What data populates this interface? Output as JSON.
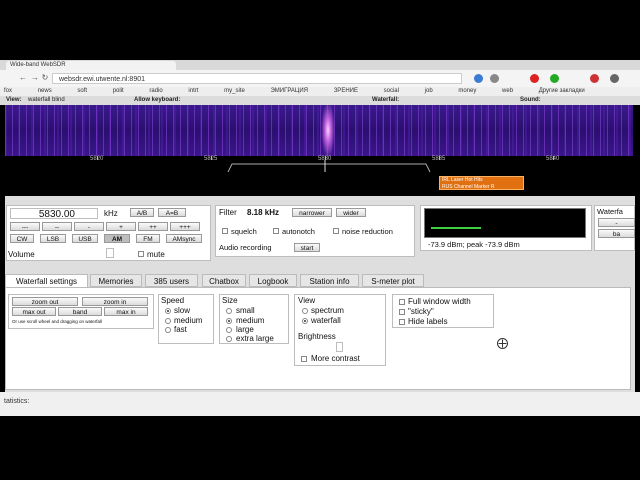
{
  "browser": {
    "tab_title": "Wide-band WebSDR",
    "url": "websdr.ewi.utwente.nl:8901",
    "bookmarks": [
      "fox",
      "news",
      "soft",
      "polit",
      "radio",
      "intrt",
      "my_site",
      "ЭМИГРАЦИЯ",
      "ЗРЕНИЕ",
      "social",
      "job",
      "money",
      "web",
      "Другие закладки"
    ]
  },
  "header": {
    "view_label": "View:",
    "view_items": "waterfall   blind",
    "keyboard_label": "Allow keyboard:",
    "waterfall_label": "Waterfall:",
    "sound_label": "Sound:"
  },
  "waterfall": {
    "scale_labels": [
      "5820",
      "5825",
      "5830",
      "5835",
      "5840"
    ],
    "marker_lines": [
      "IRL Laser Hot Hits",
      "RUS Channel Marker R"
    ]
  },
  "tuning": {
    "frequency": "5830.00",
    "unit": "kHz",
    "ab_button": "A/B",
    "a_eq_b_button": "A=B",
    "step_buttons": [
      "---",
      "--",
      "-",
      "+",
      "++",
      "+++"
    ],
    "modes": [
      "CW",
      "LSB",
      "USB",
      "AM",
      "FM",
      "AMsync"
    ],
    "active_mode": "AM",
    "volume_label": "Volume",
    "mute_label": "mute"
  },
  "filter": {
    "label": "Filter",
    "value": "8.18 kHz",
    "narrower": "narrower",
    "wider": "wider",
    "squelch": "squelch",
    "autonotch": "autonotch",
    "noise_reduction": "noise reduction",
    "audio_recording": "Audio recording",
    "start": "start"
  },
  "smeter": {
    "readout": "-73.9 dBm; peak  -73.9 dBm"
  },
  "right_panel": {
    "label": "Waterfa",
    "btn1": "-",
    "btn2": "ba"
  },
  "tabs": [
    "Waterfall settings",
    "Memories",
    "385 users",
    "Chatbox",
    "Logbook",
    "Station info",
    "S-meter plot"
  ],
  "wf_settings": {
    "zoom_out": "zoom out",
    "zoom_in": "zoom in",
    "max_out": "max out",
    "band": "band",
    "max_in": "max in",
    "hint": "Or use scroll wheel and dragging on waterfall",
    "speed_label": "Speed",
    "speed_options": [
      "slow",
      "medium",
      "fast"
    ],
    "speed_selected": "slow",
    "size_label": "Size",
    "size_options": [
      "small",
      "medium",
      "large",
      "extra large"
    ],
    "size_selected": "medium",
    "view_label": "View",
    "view_options": [
      "spectrum",
      "waterfall"
    ],
    "view_selected": "waterfall",
    "brightness_label": "Brightness",
    "more_contrast": "More contrast",
    "full_window": "Full window width",
    "sticky": "\"sticky\"",
    "hide_labels": "Hide labels"
  },
  "status": {
    "label": "tatistics:"
  }
}
